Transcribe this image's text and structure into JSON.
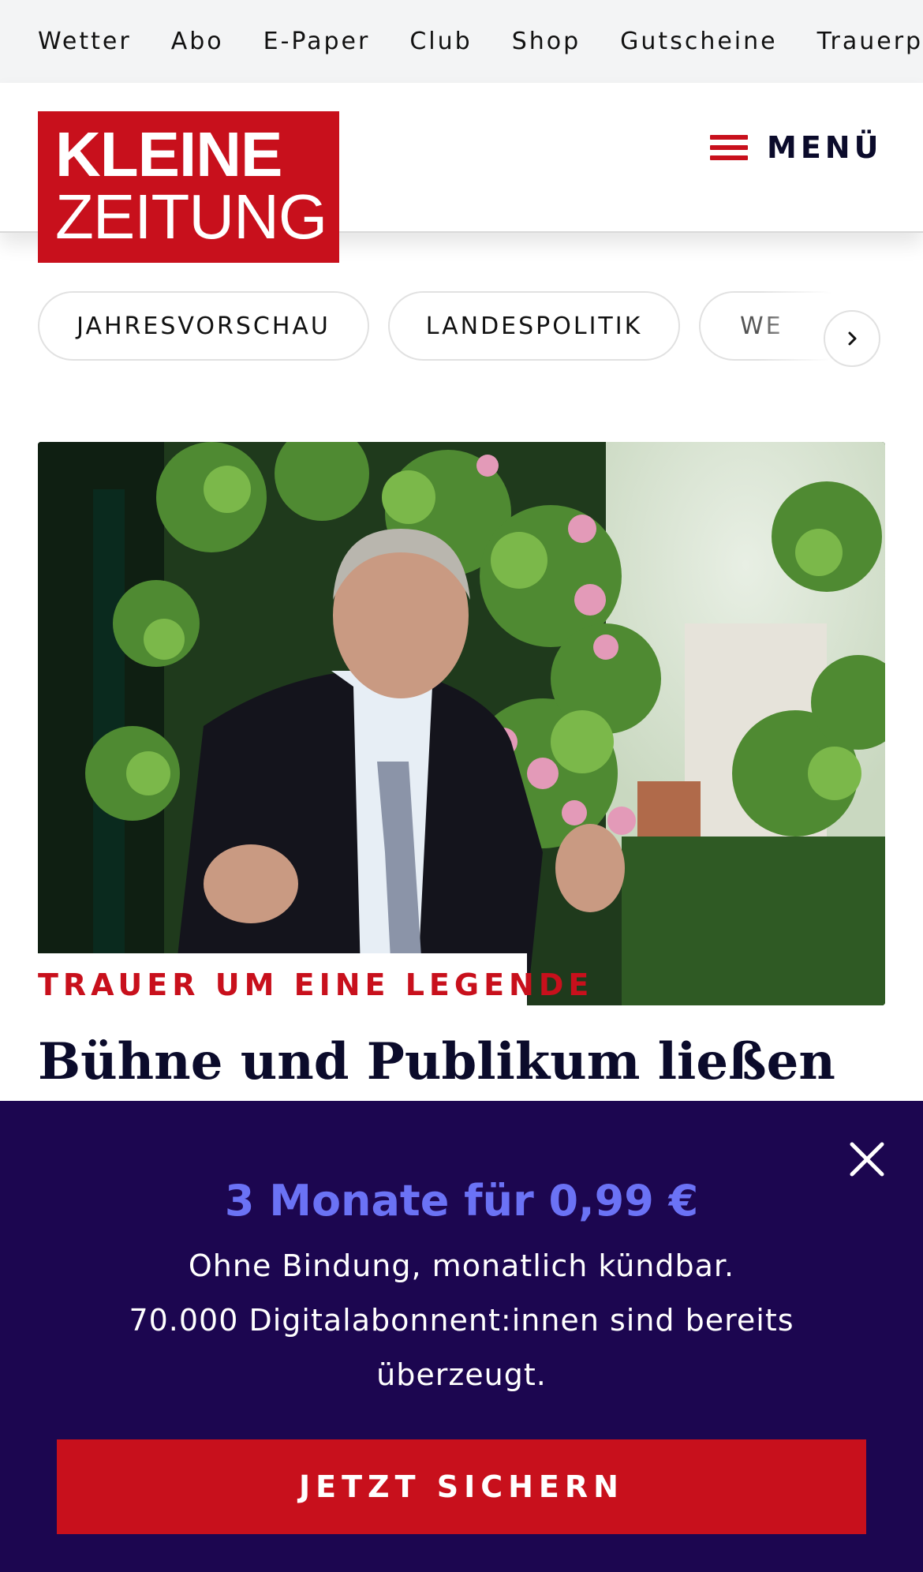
{
  "topbar": {
    "links": [
      "Wetter",
      "Abo",
      "E-Paper",
      "Club",
      "Shop",
      "Gutscheine",
      "Trauerp"
    ]
  },
  "header": {
    "logo_line1": "KLEINE",
    "logo_line2": "ZEITUNG",
    "menu_label": "MENÜ"
  },
  "topics": {
    "chips": [
      "JAHRESVORSCHAU",
      "LANDESPOLITIK",
      "WE"
    ]
  },
  "article": {
    "kicker": "TRAUER UM EINE LEGENDE",
    "headline": "Bühne und Publikum ließen"
  },
  "paywall": {
    "offer": "3 Monate für 0,99 €",
    "line1": "Ohne Bindung, monatlich kündbar.",
    "line2": "70.000 Digitalabonnent:innen sind bereits überzeugt.",
    "cta": "JETZT SICHERN"
  },
  "colors": {
    "brand_red": "#c8101c",
    "paywall_bg": "#1c0650",
    "offer_text": "#6b72f5"
  },
  "icons": {
    "menu": "hamburger-icon",
    "chips_next": "chevron-right-icon",
    "paywall_close": "close-icon"
  }
}
